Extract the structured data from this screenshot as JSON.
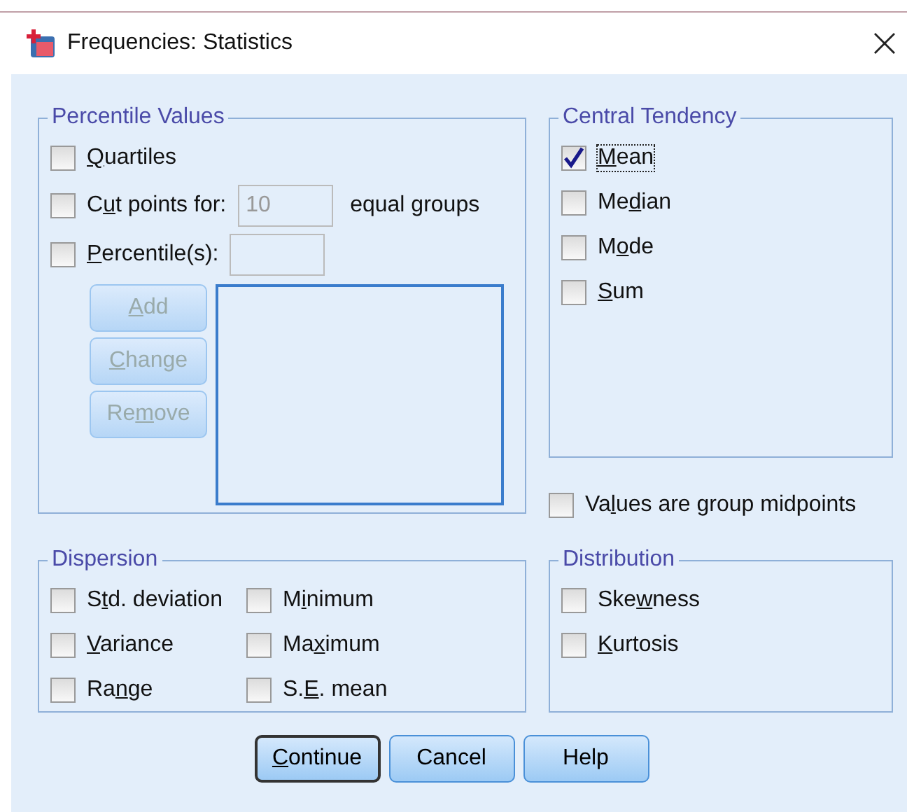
{
  "window": {
    "title": "Frequencies: Statistics"
  },
  "percentile_values": {
    "title": "Percentile Values",
    "quartiles": {
      "label": {
        "key": "Q",
        "post": "uartiles"
      },
      "checked": false
    },
    "cut_points": {
      "label": {
        "pre": "C",
        "key": "u",
        "post": "t points for:"
      },
      "checked": false,
      "value": "10",
      "suffix": "equal groups",
      "disabled": true
    },
    "percentiles": {
      "label": {
        "key": "P",
        "post": "ercentile(s):"
      },
      "checked": false,
      "disabled": true
    },
    "buttons": [
      {
        "label": {
          "key": "A",
          "post": "dd"
        },
        "disabled": true
      },
      {
        "label": {
          "key": "C",
          "post": "hange"
        },
        "disabled": true
      },
      {
        "label": {
          "pre": "Re",
          "key": "m",
          "post": "ove"
        },
        "disabled": true
      }
    ]
  },
  "central_tendency": {
    "title": "Central Tendency",
    "items": [
      {
        "label": {
          "key": "M",
          "post": "ean"
        },
        "checked": true,
        "focused": true
      },
      {
        "label": {
          "pre": "Me",
          "key": "d",
          "post": "ian"
        },
        "checked": false,
        "focused": false
      },
      {
        "label": {
          "pre": "M",
          "key": "o",
          "post": "de"
        },
        "checked": false,
        "focused": false
      },
      {
        "label": {
          "key": "S",
          "post": "um"
        },
        "checked": false,
        "focused": false
      }
    ]
  },
  "group_midpoints": {
    "label": {
      "pre": "Va",
      "key": "l",
      "post": "ues are group midpoints"
    },
    "checked": false
  },
  "dispersion": {
    "title": "Dispersion",
    "items": [
      {
        "label": {
          "pre": "S",
          "key": "t",
          "post": "d. deviation"
        },
        "checked": false
      },
      {
        "label": {
          "pre": "M",
          "key": "i",
          "post": "nimum"
        },
        "checked": false
      },
      {
        "label": {
          "key": "V",
          "post": "ariance"
        },
        "checked": false
      },
      {
        "label": {
          "pre": "Ma",
          "key": "x",
          "post": "imum"
        },
        "checked": false
      },
      {
        "label": {
          "pre": "Ra",
          "key": "n",
          "post": "ge"
        },
        "checked": false
      },
      {
        "label": {
          "pre": "S.",
          "key": "E",
          "post": ". mean"
        },
        "checked": false
      }
    ]
  },
  "distribution": {
    "title": "Distribution",
    "items": [
      {
        "label": {
          "pre": "Ske",
          "key": "w",
          "post": "ness"
        },
        "checked": false
      },
      {
        "label": {
          "key": "K",
          "post": "urtosis"
        },
        "checked": false
      }
    ]
  },
  "footer_buttons": [
    {
      "label": {
        "key": "C",
        "post": "ontinue"
      },
      "default": true
    },
    {
      "label": {
        "pre": "Cancel"
      },
      "default": false
    },
    {
      "label": {
        "pre": "Help"
      },
      "default": false
    }
  ]
}
